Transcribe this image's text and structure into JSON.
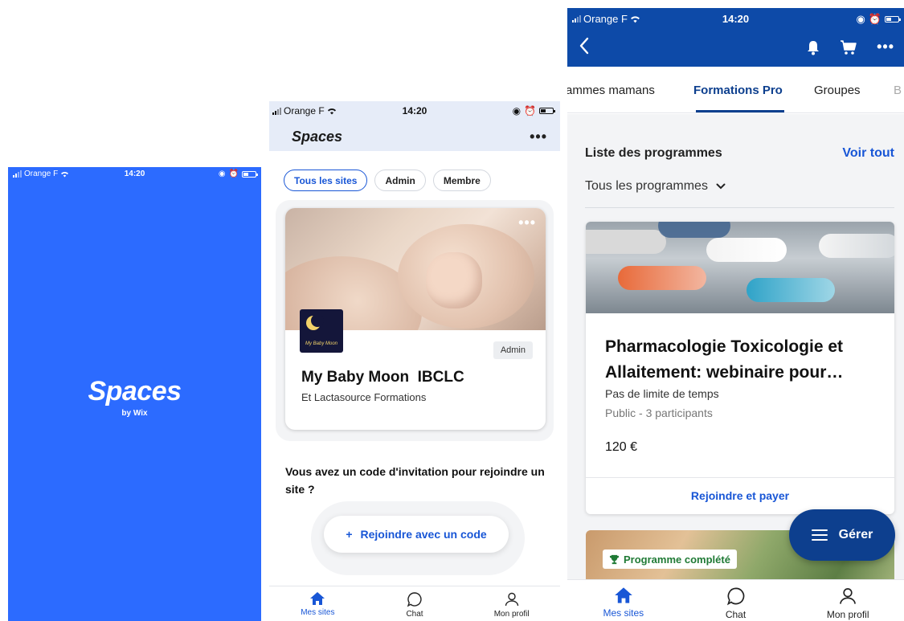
{
  "status": {
    "carrier": "Orange F",
    "time": "14:20"
  },
  "splash": {
    "logo": "Spaces",
    "by": "by Wix"
  },
  "spaces": {
    "title": "Spaces",
    "more": "•••",
    "filters": [
      "Tous les sites",
      "Admin",
      "Membre"
    ],
    "site": {
      "more": "•••",
      "logo_text": "My Baby Moon",
      "role": "Admin",
      "name": "My Baby Moon  IBCLC",
      "subtitle": "Et Lactasource Formations"
    },
    "invite_text": "Vous avez un code d'invitation pour rejoindre un site ?",
    "join_label": "Rejoindre avec un code",
    "join_icon": "+"
  },
  "tabs": [
    {
      "label": "Mes sites",
      "icon": "home-icon"
    },
    {
      "label": "Chat",
      "icon": "chat-icon"
    },
    {
      "label": "Mon profil",
      "icon": "profile-icon"
    }
  ],
  "programmes": {
    "tabs": [
      "ammes mamans",
      "Formations Pro",
      "Groupes",
      "B"
    ],
    "more": "•••",
    "list_title": "Liste des programmes",
    "see_all": "Voir tout",
    "filter": "Tous les programmes",
    "card": {
      "title": "Pharmacologie Toxicologie et Allaitement: webinaire  pour…",
      "duration": "Pas de limite de temps",
      "meta": "Public - 3 participants",
      "price": "120 €",
      "action": "Rejoindre et payer"
    },
    "completed_badge": "Programme complété",
    "manage": "Gérer"
  },
  "colors": {
    "splash_blue": "#2c6bff",
    "header_blue": "#0d4aa8",
    "accent": "#1856d6",
    "dark_blue": "#0d3f8e"
  }
}
